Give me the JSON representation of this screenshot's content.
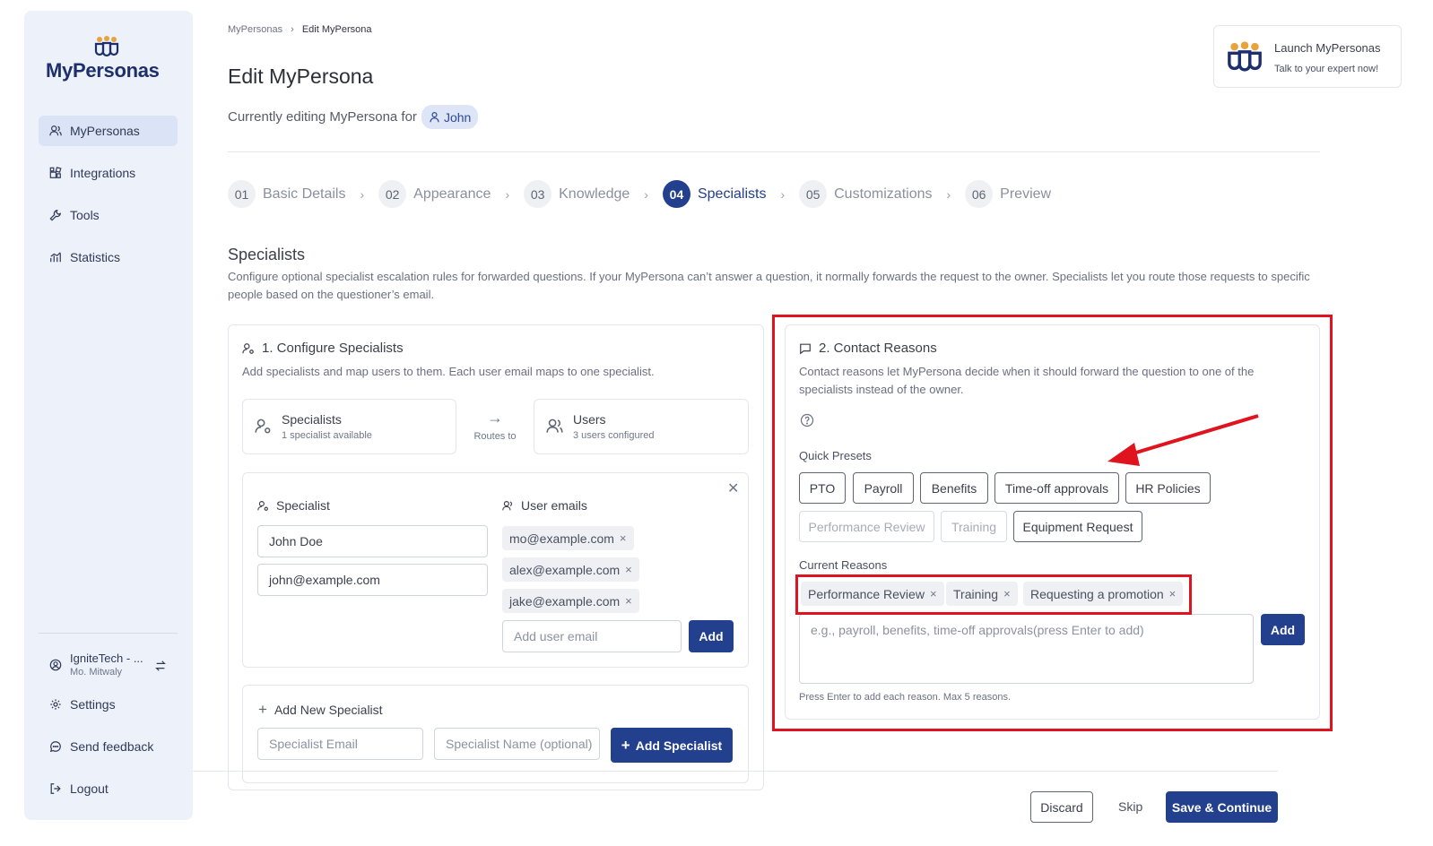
{
  "app": {
    "name": "MyPersonas"
  },
  "sidebar": {
    "items": [
      {
        "label": "MyPersonas",
        "icon": "users-icon"
      },
      {
        "label": "Integrations",
        "icon": "puzzle-icon"
      },
      {
        "label": "Tools",
        "icon": "wrench-icon"
      },
      {
        "label": "Statistics",
        "icon": "chart-icon"
      }
    ],
    "account": {
      "org": "IgniteTech - ...",
      "user": "Mo. Mitwaly"
    },
    "bottom": [
      {
        "label": "Settings"
      },
      {
        "label": "Send feedback"
      },
      {
        "label": "Logout"
      }
    ]
  },
  "breadcrumb": {
    "root": "MyPersonas",
    "current": "Edit MyPersona"
  },
  "page": {
    "title": "Edit MyPersona",
    "editing_prefix": "Currently editing MyPersona for",
    "editing_user": "John"
  },
  "steps": [
    {
      "num": "01",
      "label": "Basic Details"
    },
    {
      "num": "02",
      "label": "Appearance"
    },
    {
      "num": "03",
      "label": "Knowledge"
    },
    {
      "num": "04",
      "label": "Specialists",
      "active": true
    },
    {
      "num": "05",
      "label": "Customizations"
    },
    {
      "num": "06",
      "label": "Preview"
    }
  ],
  "section": {
    "title": "Specialists",
    "description": "Configure optional specialist escalation rules for forwarded questions. If your MyPersona can’t answer a question, it normally forwards the request to the owner. Specialists let you route those requests to specific people based on the questioner’s email."
  },
  "configure": {
    "title": "1. Configure Specialists",
    "description": "Add specialists and map users to them. Each user email maps to one specialist.",
    "summary_specialists": {
      "title": "Specialists",
      "sub": "1 specialist available"
    },
    "routes_to": "Routes to",
    "summary_users": {
      "title": "Users",
      "sub": "3 users configured"
    },
    "specialist_label": "Specialist",
    "specialist_name": "John Doe",
    "specialist_email": "john@example.com",
    "user_emails_label": "User emails",
    "user_emails": [
      "mo@example.com",
      "alex@example.com",
      "jake@example.com"
    ],
    "add_user_placeholder": "Add user email",
    "add_button": "Add",
    "add_new_title": "Add New Specialist",
    "new_email_placeholder": "Specialist Email",
    "new_name_placeholder": "Specialist Name (optional)",
    "add_specialist_button": "Add Specialist"
  },
  "contact": {
    "title": "2. Contact Reasons",
    "description": "Contact reasons let MyPersona decide when it should forward the question to one of the specialists instead of the owner.",
    "quick_presets_label": "Quick Presets",
    "presets": [
      {
        "label": "PTO",
        "disabled": false
      },
      {
        "label": "Payroll",
        "disabled": false
      },
      {
        "label": "Benefits",
        "disabled": false
      },
      {
        "label": "Time-off approvals",
        "disabled": false
      },
      {
        "label": "HR Policies",
        "disabled": false
      },
      {
        "label": "Performance Review",
        "disabled": true
      },
      {
        "label": "Training",
        "disabled": true
      },
      {
        "label": "Equipment Request",
        "disabled": false
      }
    ],
    "current_label": "Current Reasons",
    "current": [
      "Performance Review",
      "Training",
      "Requesting a promotion"
    ],
    "input_placeholder": "e.g., payroll, benefits, time-off approvals(press Enter to add)",
    "add_button": "Add",
    "hint": "Press Enter to add each reason. Max 5 reasons."
  },
  "footer": {
    "discard": "Discard",
    "skip": "Skip",
    "save": "Save & Continue"
  },
  "launch": {
    "title": "Launch MyPersonas",
    "subtitle": "Talk to your expert now!"
  },
  "colors": {
    "primary": "#23408e",
    "highlight": "#e0141e",
    "sidebar_bg": "#edf1fa"
  }
}
